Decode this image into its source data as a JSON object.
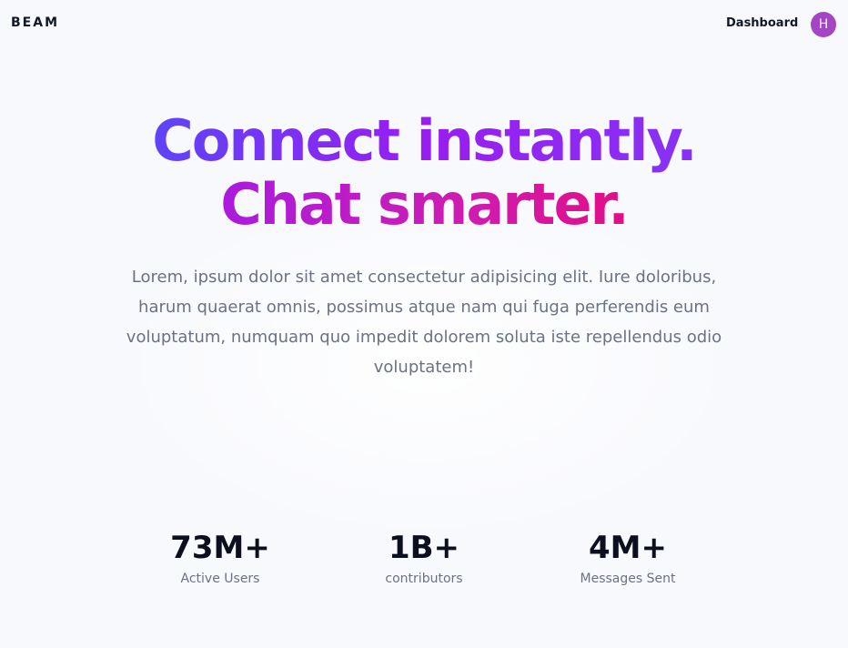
{
  "header": {
    "logo": "BEAM",
    "nav_link": "Dashboard",
    "avatar_initial": "H",
    "avatar_color": "#a445c6"
  },
  "hero": {
    "headline_line1": "Connect instantly.",
    "headline_line2": "Chat smarter.",
    "subtitle": "Lorem, ipsum dolor sit amet consectetur adipisicing elit. Iure doloribus, harum quaerat omnis, possimus atque nam qui fuga perferendis eum voluptatum, numquam quo impedit dolorem soluta iste repellendus odio voluptatem!"
  },
  "stats": [
    {
      "value": "73M+",
      "label": "Active Users"
    },
    {
      "value": "1B+",
      "label": "contributors"
    },
    {
      "value": "4M+",
      "label": "Messages Sent"
    }
  ],
  "colors": {
    "gradient_blue": "#3d5afe",
    "gradient_purple": "#9a1df0",
    "gradient_pink": "#e8097a",
    "background": "#f8f9fd",
    "text_dark": "#111827",
    "text_muted": "#6b7280"
  }
}
